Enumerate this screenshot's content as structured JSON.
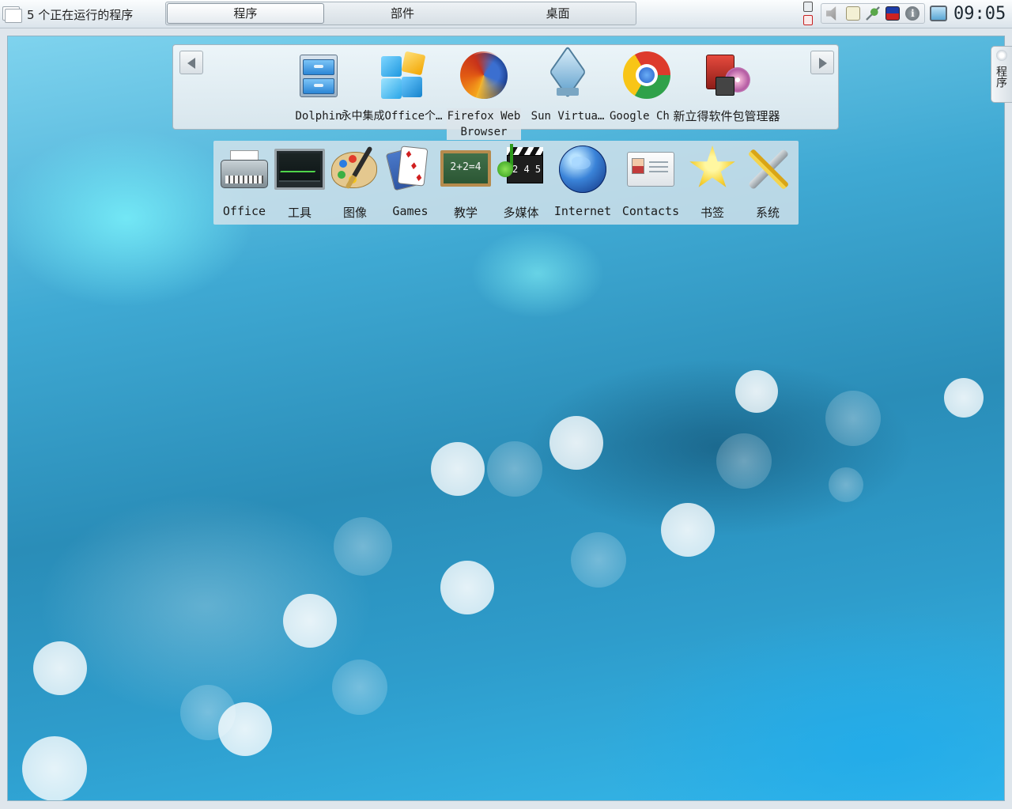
{
  "panel": {
    "running_apps_label": "5 个正在运行的程序",
    "tabs": [
      {
        "label": "程序",
        "active": true
      },
      {
        "label": "部件",
        "active": false
      },
      {
        "label": "桌面",
        "active": false
      }
    ],
    "tray_icons": [
      "lock-icon",
      "logout-icon",
      "speaker-icon",
      "clipboard-icon",
      "network-icon",
      "keyboard-layout-icon",
      "info-icon",
      "desktop-switch-icon"
    ],
    "clock": "09:05"
  },
  "side_toolbox": {
    "label": "程序"
  },
  "favorites": {
    "items": [
      {
        "label": "Dolphin",
        "icon": "file-manager-icon"
      },
      {
        "label": "永中集成Office个…",
        "icon": "office-integration-icon"
      },
      {
        "label": "Firefox Web Browser",
        "icon": "firefox-icon"
      },
      {
        "label": "Sun Virtua…",
        "icon": "virtualbox-icon"
      },
      {
        "label": "Google Chrome",
        "icon": "chrome-icon"
      },
      {
        "label": "新立得软件包管理器",
        "icon": "package-manager-icon"
      }
    ]
  },
  "categories": {
    "items": [
      {
        "label": "Office",
        "icon": "typewriter-icon"
      },
      {
        "label": "工具",
        "icon": "monitor-icon"
      },
      {
        "label": "图像",
        "icon": "palette-icon"
      },
      {
        "label": "Games",
        "icon": "cards-icon"
      },
      {
        "label": "教学",
        "icon": "chalkboard-icon",
        "board_text": "2+2=4"
      },
      {
        "label": "多媒体",
        "icon": "multimedia-icon",
        "clap_text": "2 4 5"
      },
      {
        "label": "Internet",
        "icon": "globe-icon"
      },
      {
        "label": "Contacts",
        "icon": "contact-card-icon"
      },
      {
        "label": "书签",
        "icon": "star-icon"
      },
      {
        "label": "系统",
        "icon": "tools-icon"
      }
    ]
  },
  "colors": {
    "desktop_light": "#7fd3ee",
    "desktop_dark": "#2a8db8",
    "panel_bg": "#eef2f5"
  }
}
